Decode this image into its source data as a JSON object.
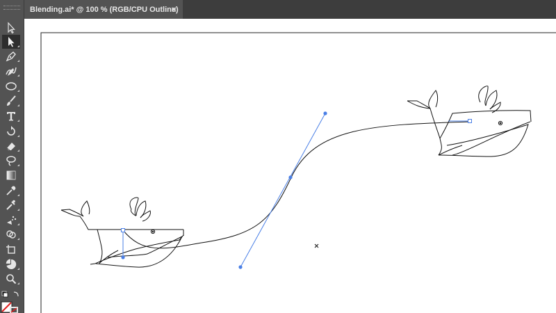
{
  "document": {
    "tab_title": "Blending.ai* @ 100 % (RGB/CPU Outline)",
    "close_glyph": "×"
  },
  "toolbar": {
    "tools": [
      {
        "name": "direct-selection-tool",
        "icon": "hollow-arrow-icon"
      },
      {
        "name": "selection-tool",
        "icon": "arrow-icon",
        "active": true
      },
      {
        "name": "pen-tool",
        "icon": "pen-icon"
      },
      {
        "name": "curvature-tool",
        "icon": "curvature-pen-icon"
      },
      {
        "name": "ellipse-tool",
        "icon": "ellipse-icon"
      },
      {
        "name": "paintbrush-tool",
        "icon": "brush-icon"
      },
      {
        "name": "type-tool",
        "icon": "type-icon"
      },
      {
        "name": "rotate-tool",
        "icon": "rotate-icon"
      },
      {
        "name": "eraser-tool",
        "icon": "eraser-icon"
      },
      {
        "name": "lasso-tool",
        "icon": "lasso-icon"
      },
      {
        "name": "gradient-tool",
        "icon": "gradient-icon"
      },
      {
        "name": "eyedropper-tool",
        "icon": "eyedropper-icon"
      },
      {
        "name": "blend-tool",
        "icon": "blend-icon"
      },
      {
        "name": "symbol-sprayer-tool",
        "icon": "sprayer-icon"
      },
      {
        "name": "shape-builder-tool",
        "icon": "shape-builder-icon"
      },
      {
        "name": "artboard-tool",
        "icon": "artboard-icon"
      },
      {
        "name": "pie-graph-tool",
        "icon": "pie-chart-icon"
      },
      {
        "name": "zoom-tool",
        "icon": "magnifier-icon"
      }
    ],
    "fill_color": "#ffffff",
    "stroke_none_color": "#e02020"
  },
  "colors": {
    "selection_blue": "#4a7fe6",
    "path_black": "#111111",
    "artboard_border": "#222222"
  }
}
